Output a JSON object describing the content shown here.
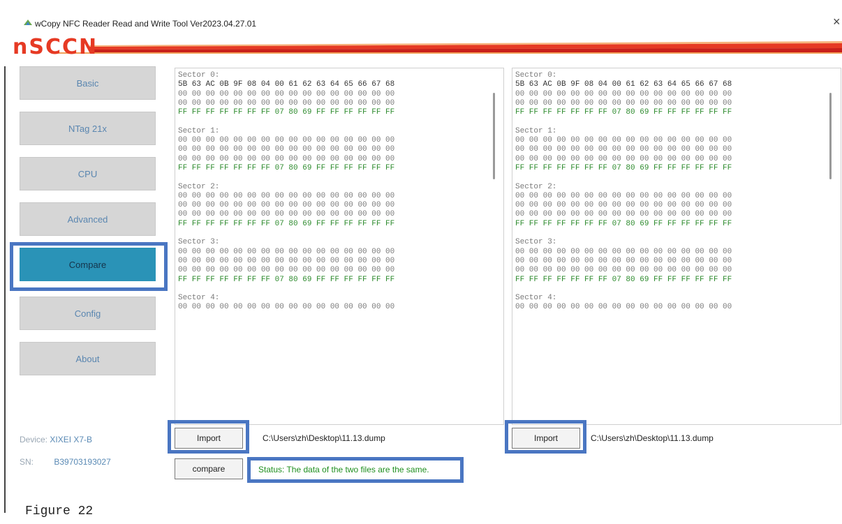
{
  "window": {
    "title": "wCopy NFC Reader Read and Write Tool Ver2023.04.27.01",
    "close_glyph": "×"
  },
  "brand": {
    "logo": "nSCCN"
  },
  "nav": {
    "items": [
      "Basic",
      "NTag 21x",
      "CPU",
      "Advanced",
      "Compare",
      "Config",
      "About"
    ],
    "active": "Compare"
  },
  "device": {
    "device_label": "Device:",
    "device_value": "XIXEI X7-B",
    "sn_label": "SN:",
    "sn_value": "B39703193027"
  },
  "left_panel": {
    "sectors": [
      {
        "label": "Sector 0:",
        "rows": [
          "5B 63 AC 0B 9F 08 04 00 61 62 63 64 65 66 67 68",
          "00 00 00 00 00 00 00 00 00 00 00 00 00 00 00 00",
          "00 00 00 00 00 00 00 00 00 00 00 00 00 00 00 00",
          "FF FF FF FF FF FF FF 07 80 69 FF FF FF FF FF FF"
        ]
      },
      {
        "label": "Sector 1:",
        "rows": [
          "00 00 00 00 00 00 00 00 00 00 00 00 00 00 00 00",
          "00 00 00 00 00 00 00 00 00 00 00 00 00 00 00 00",
          "00 00 00 00 00 00 00 00 00 00 00 00 00 00 00 00",
          "FF FF FF FF FF FF FF 07 80 69 FF FF FF FF FF FF"
        ]
      },
      {
        "label": "Sector 2:",
        "rows": [
          "00 00 00 00 00 00 00 00 00 00 00 00 00 00 00 00",
          "00 00 00 00 00 00 00 00 00 00 00 00 00 00 00 00",
          "00 00 00 00 00 00 00 00 00 00 00 00 00 00 00 00",
          "FF FF FF FF FF FF FF 07 80 69 FF FF FF FF FF FF"
        ]
      },
      {
        "label": "Sector 3:",
        "rows": [
          "00 00 00 00 00 00 00 00 00 00 00 00 00 00 00 00",
          "00 00 00 00 00 00 00 00 00 00 00 00 00 00 00 00",
          "00 00 00 00 00 00 00 00 00 00 00 00 00 00 00 00",
          "FF FF FF FF FF FF FF 07 80 69 FF FF FF FF FF FF"
        ]
      },
      {
        "label": "Sector 4:",
        "rows": [
          "00 00 00 00 00 00 00 00 00 00 00 00 00 00 00 00"
        ]
      }
    ]
  },
  "right_panel": {
    "sectors": [
      {
        "label": "Sector 0:",
        "rows": [
          "5B 63 AC 0B 9F 08 04 00 61 62 63 64 65 66 67 68",
          "00 00 00 00 00 00 00 00 00 00 00 00 00 00 00 00",
          "00 00 00 00 00 00 00 00 00 00 00 00 00 00 00 00",
          "FF FF FF FF FF FF FF 07 80 69 FF FF FF FF FF FF"
        ]
      },
      {
        "label": "Sector 1:",
        "rows": [
          "00 00 00 00 00 00 00 00 00 00 00 00 00 00 00 00",
          "00 00 00 00 00 00 00 00 00 00 00 00 00 00 00 00",
          "00 00 00 00 00 00 00 00 00 00 00 00 00 00 00 00",
          "FF FF FF FF FF FF FF 07 80 69 FF FF FF FF FF FF"
        ]
      },
      {
        "label": "Sector 2:",
        "rows": [
          "00 00 00 00 00 00 00 00 00 00 00 00 00 00 00 00",
          "00 00 00 00 00 00 00 00 00 00 00 00 00 00 00 00",
          "00 00 00 00 00 00 00 00 00 00 00 00 00 00 00 00",
          "FF FF FF FF FF FF FF 07 80 69 FF FF FF FF FF FF"
        ]
      },
      {
        "label": "Sector 3:",
        "rows": [
          "00 00 00 00 00 00 00 00 00 00 00 00 00 00 00 00",
          "00 00 00 00 00 00 00 00 00 00 00 00 00 00 00 00",
          "00 00 00 00 00 00 00 00 00 00 00 00 00 00 00 00",
          "FF FF FF FF FF FF FF 07 80 69 FF FF FF FF FF FF"
        ]
      },
      {
        "label": "Sector 4:",
        "rows": [
          "00 00 00 00 00 00 00 00 00 00 00 00 00 00 00 00"
        ]
      }
    ]
  },
  "controls": {
    "import_left_label": "Import",
    "left_path": "C:\\Users\\zh\\Desktop\\11.13.dump",
    "import_right_label": "Import",
    "right_path": "C:\\Users\\zh\\Desktop\\11.13.dump",
    "compare_label": "compare",
    "status": "Status: The data of the two files are the same."
  },
  "caption": "Figure 22",
  "colors": {
    "accent_highlight": "#4a76c2",
    "active_nav": "#2a93b7",
    "brand_red": "#e63a24",
    "status_green": "#1f8f1f",
    "ff_green": "#2e8b2e"
  }
}
